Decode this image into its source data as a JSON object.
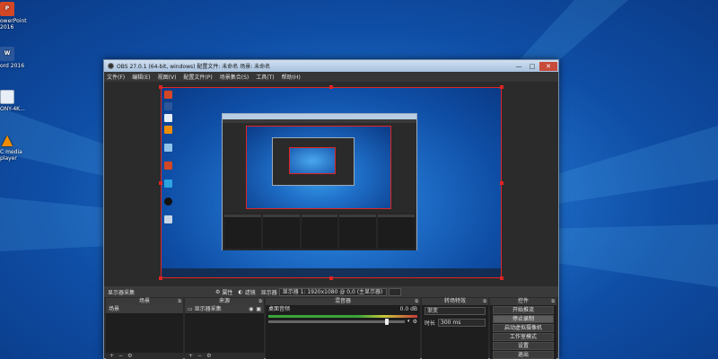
{
  "desktop": {
    "icons": [
      {
        "label": "owerPoint",
        "label2": "2016",
        "color": "#d24726",
        "glyph": "P"
      },
      {
        "label": "ord 2016",
        "label2": "",
        "color": "#2b579a",
        "glyph": "W"
      },
      {
        "label": "ONY-4K...",
        "label2": "",
        "color": "#e8eef6",
        "glyph": ""
      },
      {
        "label": "C media",
        "label2": "player",
        "color": "#f08c00",
        "glyph": "▲"
      }
    ]
  },
  "window": {
    "title": "OBS 27.0.1 (64-bit, windows)  配置文件: 未命名  场景: 未命名",
    "controls": {
      "minimize": "—",
      "maximize": "□",
      "close": "✕"
    }
  },
  "menu": [
    "文件(F)",
    "编辑(E)",
    "视图(V)",
    "配置文件(P)",
    "场景集合(S)",
    "工具(T)",
    "帮助(H)"
  ],
  "source_toolbar": {
    "selected_source": "显示器采集",
    "properties": "属性",
    "filters": "滤镜",
    "display_label": "显示器",
    "resolution": "显示器 1: 1920x1080 @ 0,0 (主显示器)"
  },
  "docks": {
    "scenes": {
      "title": "场景",
      "items": [
        "场景"
      ]
    },
    "sources": {
      "title": "来源",
      "items": [
        "显示器采集"
      ]
    },
    "mixer": {
      "title": "混音器",
      "track": "桌面音频",
      "db": "0.0 dB"
    },
    "transitions": {
      "title": "转场特效",
      "type": "渐变",
      "duration_label": "时长",
      "duration_value": "300 ms"
    },
    "controls": {
      "title": "控件",
      "buttons": [
        "开始推流",
        "停止录制",
        "启动虚拟摄像机",
        "工作室模式",
        "设置",
        "退出"
      ]
    }
  }
}
